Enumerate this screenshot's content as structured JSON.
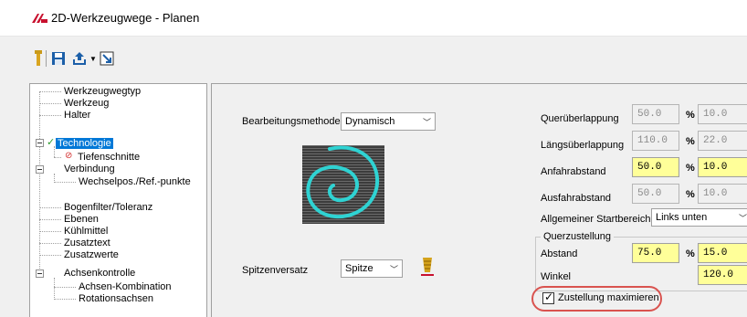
{
  "window": {
    "title": "2D-Werkzeugwege - Planen"
  },
  "colors": {
    "selection": "#0078d7",
    "highlight_field": "#ffff99",
    "callout": "#d9534f",
    "preview_stroke": "#2fd3d3"
  },
  "toolbar": {
    "icons": [
      "tool-icon",
      "save-icon",
      "export-icon",
      "dropdown-arrow-icon",
      "resize-icon"
    ]
  },
  "tree": {
    "items": [
      {
        "label": "Werkzeugwegtyp"
      },
      {
        "label": "Werkzeug"
      },
      {
        "label": "Halter"
      },
      {
        "label": "Technologie"
      },
      {
        "label": "Tiefenschnitte"
      },
      {
        "label": "Verbindung"
      },
      {
        "label": "Wechselpos./Ref.-punkte"
      },
      {
        "label": "Bogenfilter/Toleranz"
      },
      {
        "label": "Ebenen"
      },
      {
        "label": "Kühlmittel"
      },
      {
        "label": "Zusatztext"
      },
      {
        "label": "Zusatzwerte"
      },
      {
        "label": "Achsenkontrolle"
      },
      {
        "label": "Achsen-Kombination"
      },
      {
        "label": "Rotationsachsen"
      }
    ]
  },
  "main": {
    "bearbeitungsmethode": {
      "label": "Bearbeitungsmethode",
      "value": "Dynamisch"
    },
    "spitzenversatz": {
      "label": "Spitzenversatz",
      "value": "Spitze"
    },
    "queruberlappung": {
      "label": "Querüberlappung",
      "value1": "50.0",
      "pct": "%",
      "value2": "10.0"
    },
    "langsuberlappung": {
      "label": "Längsüberlappung",
      "value1": "110.0",
      "pct": "%",
      "value2": "22.0"
    },
    "anfahrabstand": {
      "label": "Anfahrabstand",
      "value1": "50.0",
      "pct": "%",
      "value2": "10.0"
    },
    "ausfahrabstand": {
      "label": "Ausfahrabstand",
      "value1": "50.0",
      "pct": "%",
      "value2": "10.0"
    },
    "startbereich": {
      "label": "Allgemeiner Startbereich",
      "value": "Links unten"
    },
    "querzustellung": {
      "title": "Querzustellung",
      "abstand_label": "Abstand",
      "abstand_value1": "75.0",
      "pct": "%",
      "abstand_value2": "15.0",
      "winkel_label": "Winkel",
      "winkel_value": "120.0"
    },
    "zustellung_maximieren": {
      "label": "Zustellung maximieren",
      "checked": true
    }
  }
}
